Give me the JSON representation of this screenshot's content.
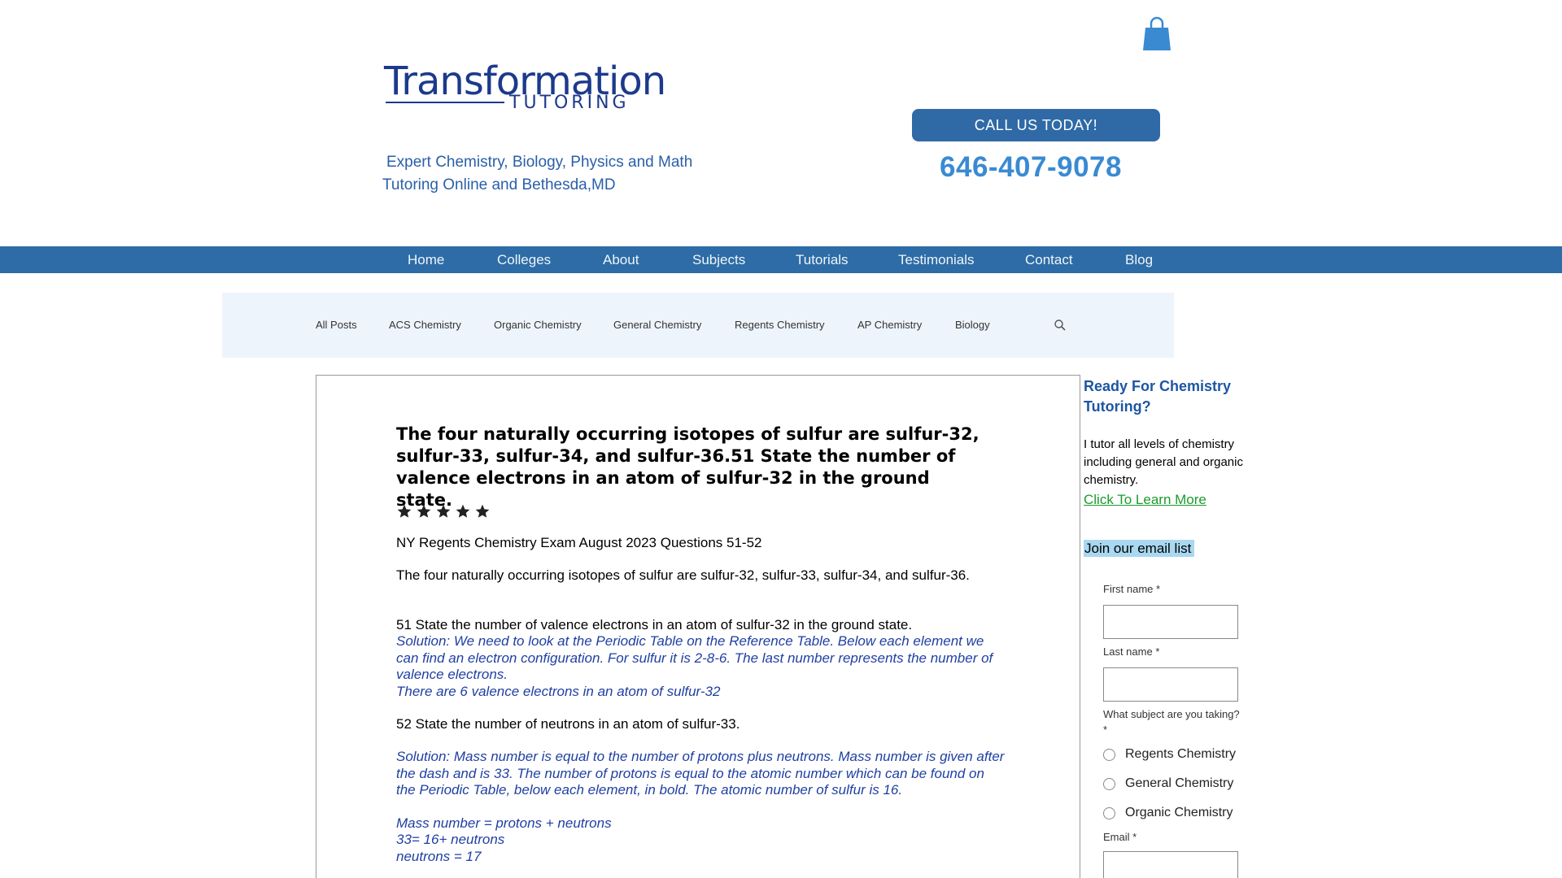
{
  "brand": {
    "logo_word": "Transformation",
    "logo_sub": "TUTORING",
    "tagline_line1": "Expert Chemistry, Biology, Physics and Math",
    "tagline_line2": "Tutoring Online and Bethesda,MD"
  },
  "header": {
    "cta_label": "CALL US TODAY!",
    "phone": "646-407-9078",
    "cart_icon": "shopping-bag-icon",
    "brand_color": "#2d6ca6"
  },
  "nav": {
    "items": [
      "Home",
      "Colleges",
      "About",
      "Subjects",
      "Tutorials",
      "Testimonials",
      "Contact",
      "Blog"
    ]
  },
  "categories": {
    "items": [
      "All Posts",
      "ACS Chemistry",
      "Organic Chemistry",
      "General Chemistry",
      "Regents Chemistry",
      "AP Chemistry",
      "Biology"
    ],
    "search_icon": "search-icon"
  },
  "post": {
    "title": "The four naturally occurring isotopes of sulfur are sulfur-32, sulfur-33, sulfur-34, and sulfur-36.51 State the number of valence electrons in an atom of sulfur-32 in the ground state.",
    "rating": 5,
    "exam_line": "NY Regents Chemistry Exam August 2023 Questions 51-52",
    "intro": "The four naturally occurring isotopes of sulfur are sulfur-32, sulfur-33, sulfur-34, and sulfur-36.",
    "q51": "51 State the number of valence electrons in an atom of sulfur-32 in the ground state.",
    "sol51": "Solution: We need to look at the Periodic Table on the Reference Table. Below each element we can find an electron configuration. For sulfur it is 2-8-6. The last number represents the number of valence electrons.",
    "ans51": "There are 6 valence electrons in an atom of sulfur-32",
    "q52": "52 State the number of neutrons in an atom of sulfur-33.",
    "sol52": "Solution: Mass number is equal to the number of protons plus neutrons. Mass number is given after the dash and is 33. The number of protons is equal to the atomic number which can be found on the Periodic Table, below each element, in bold. The atomic number of sulfur is 16.",
    "eq1": "Mass number = protons + neutrons",
    "eq2": "33= 16+ neutrons",
    "eq3": "neutrons = 17"
  },
  "sidebar": {
    "heading": "Ready For Chemistry Tutoring?",
    "text": "I tutor all levels of chemistry including general and organic chemistry.",
    "link": "Click To Learn More",
    "join": "Join our email list",
    "first_name_label": "First name *",
    "last_name_label": "Last name *",
    "subject_label": "What subject are you taking? *",
    "subjects": [
      "Regents Chemistry",
      "General Chemistry",
      "Organic Chemistry"
    ],
    "email_label": "Email *"
  }
}
